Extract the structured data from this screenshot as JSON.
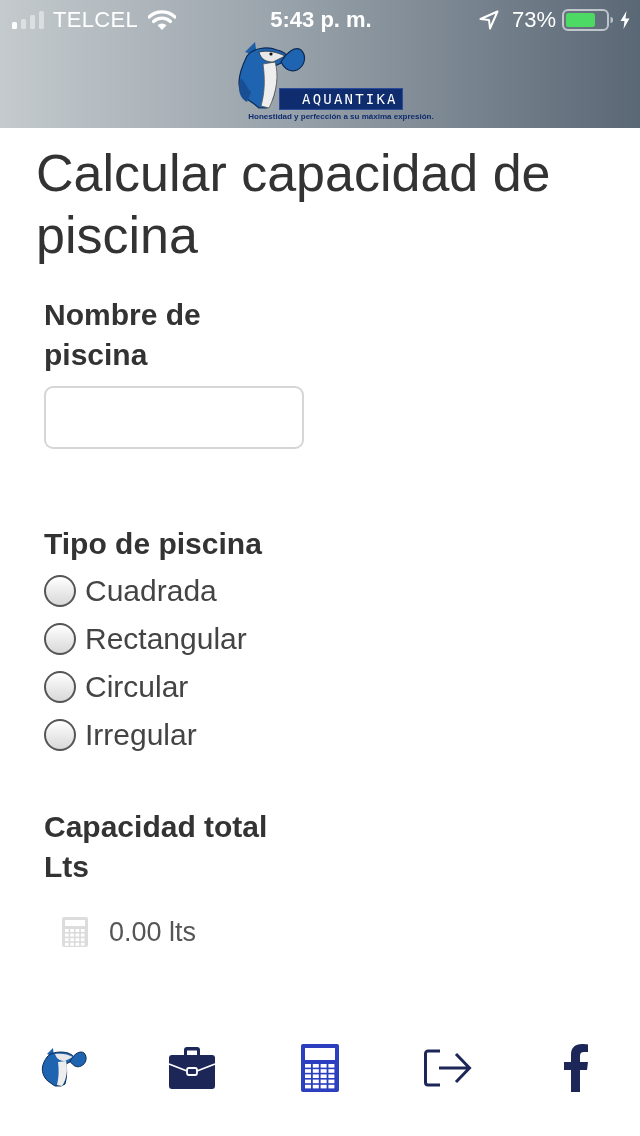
{
  "status_bar": {
    "carrier": "TELCEL",
    "time": "5:43 p. m.",
    "battery": "73%"
  },
  "header": {
    "logo_text": "AQUANTIKA",
    "tagline": "Honestidad y perfección a su máxima expresión."
  },
  "title": "Calcular capacidad de piscina",
  "name_field": {
    "label": "Nombre de piscina"
  },
  "pool_type": {
    "label": "Tipo de piscina",
    "options": [
      {
        "label": "Cuadrada",
        "selected": false
      },
      {
        "label": "Rectangular",
        "selected": false
      },
      {
        "label": "Circular",
        "selected": false
      },
      {
        "label": "Irregular",
        "selected": false
      }
    ]
  },
  "capacity": {
    "label": "Capacidad total Lts",
    "value": "0.00 lts"
  },
  "tab_bar": {
    "tabs": [
      {
        "selected": false
      },
      {
        "selected": false
      },
      {
        "selected": true
      },
      {
        "selected": false
      },
      {
        "selected": false
      }
    ]
  }
}
